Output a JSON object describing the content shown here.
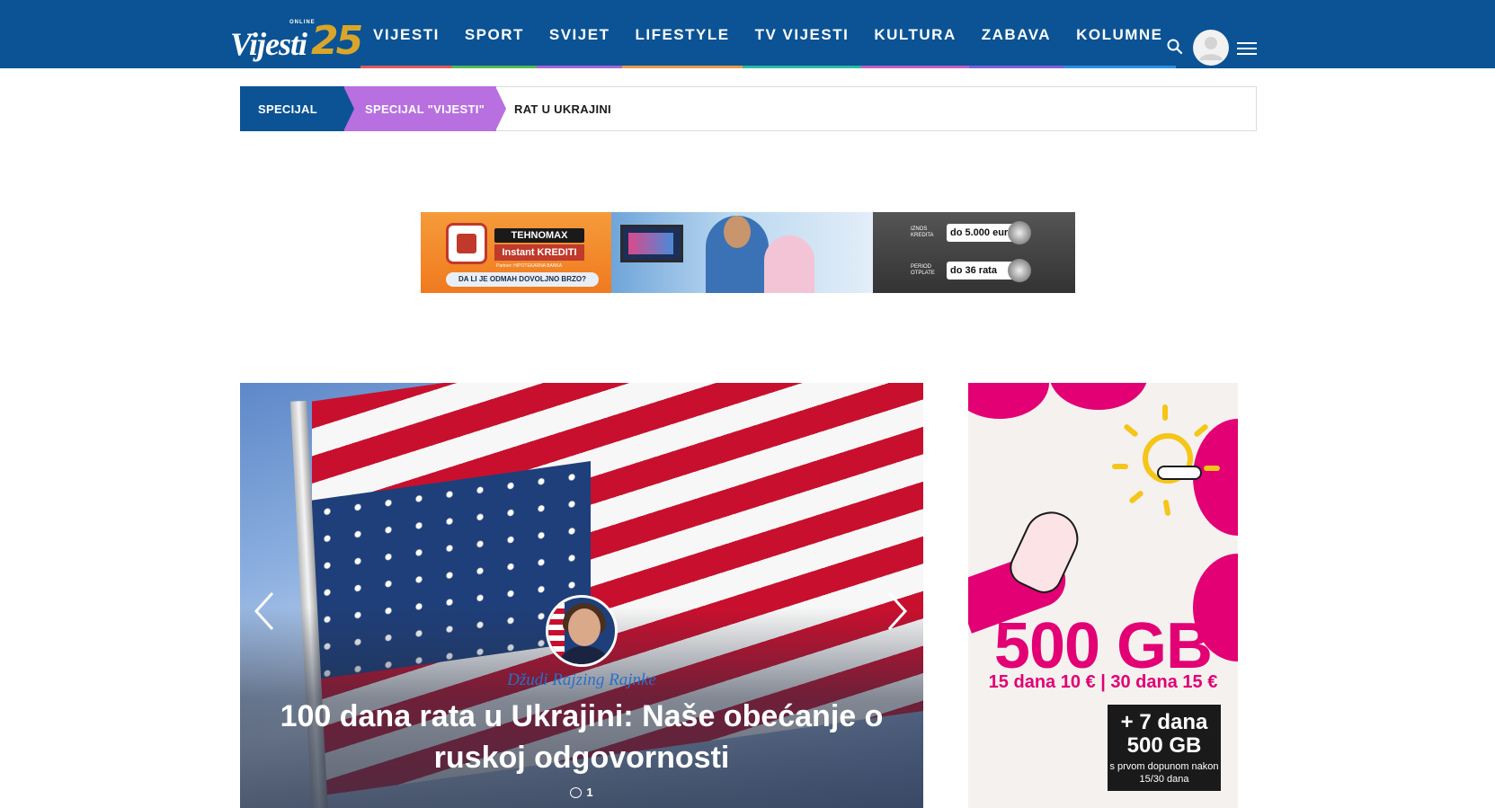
{
  "brand": {
    "logo_word": "Vijesti",
    "logo_online": "ONLINE",
    "logo_number": "25"
  },
  "nav": {
    "items": [
      {
        "label": "VIJESTI",
        "color": "#e05a5a"
      },
      {
        "label": "SPORT",
        "color": "#53b85a"
      },
      {
        "label": "SVIJET",
        "color": "#a565d8"
      },
      {
        "label": "LIFESTYLE",
        "color": "#e89a4a"
      },
      {
        "label": "TV VIJESTI",
        "color": "#2cb9a4"
      },
      {
        "label": "KULTURA",
        "color": "#c060c8"
      },
      {
        "label": "ZABAVA",
        "color": "#7a62d8"
      },
      {
        "label": "KOLUMNE",
        "color": "#2d8ee0"
      }
    ],
    "search_icon": "search-icon",
    "avatar_icon": "user-avatar-icon",
    "menu_icon": "hamburger-menu-icon"
  },
  "breadcrumb": {
    "items": [
      "SPECIJAL",
      "SPECIJAL \"VIJESTI\"",
      "RAT U UKRAJINI"
    ]
  },
  "banner_ad": {
    "brand": "TEHNOMAX",
    "tagline": "Instant KREDITI",
    "partner": "Partner: HIPOTEKARNA BANKA",
    "question": "DA LI JE ODMAH DOVOLJNO BRZO?",
    "amount_label": "IZNOS KREDITA",
    "amount_value": "do 5.000 eur",
    "period_label": "PERIOD OTPLATE",
    "period_value": "do 36 rata"
  },
  "hero": {
    "author": "Džudi Rajzing Rajnke",
    "title": "100 dana rata u Ukrajini: Naše obećanje o ruskoj odgovornosti",
    "comment_count": "1",
    "prev_icon": "chevron-left-icon",
    "next_icon": "chevron-right-icon"
  },
  "side_ad": {
    "headline": "500 GB",
    "prices": "15 dana 10 € | 30 dana 15 €",
    "bonus_line1": "+ 7 dana",
    "bonus_line2": "500 GB",
    "bonus_note": "s prvom dopunom nakon 15/30 dana",
    "accent": "#e20074"
  }
}
